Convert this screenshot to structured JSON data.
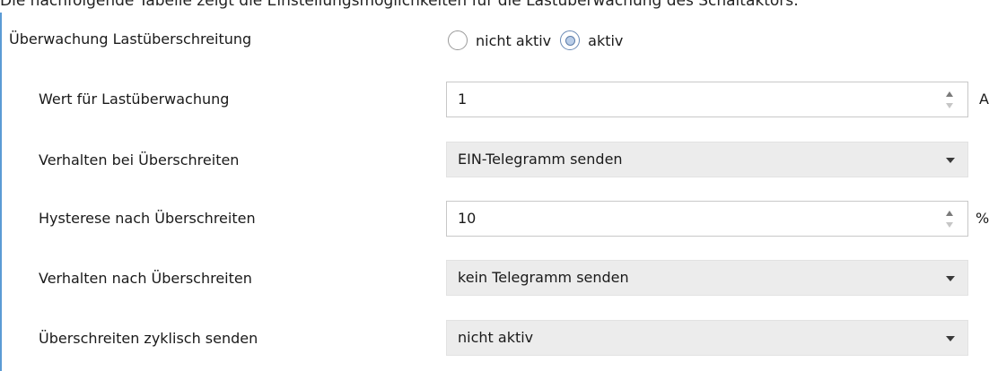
{
  "header_strip": {
    "text": "Die nachfolgende Tabelle zeigt die Einstellungsmöglichkeiten für die Lastüberwachung des Schaltaktors:"
  },
  "monitoring": {
    "label": "Überwachung Lastüberschreitung",
    "options": [
      {
        "label": "nicht aktiv",
        "selected": false
      },
      {
        "label": "aktiv",
        "selected": true
      }
    ]
  },
  "rows": [
    {
      "label": "Wert für Lastüberwachung",
      "type": "spinbox",
      "value": "1",
      "unit": "A"
    },
    {
      "label": "Verhalten bei Überschreiten",
      "type": "dropdown",
      "value": "EIN-Telegramm senden"
    },
    {
      "label": "Hysterese nach Überschreiten",
      "type": "spinbox",
      "value": "10",
      "unit": "%"
    },
    {
      "label": "Verhalten nach Überschreiten",
      "type": "dropdown",
      "value": "kein Telegramm senden"
    },
    {
      "label": "Überschreiten zyklisch senden",
      "type": "dropdown",
      "value": "nicht aktiv"
    }
  ],
  "colors": {
    "panel_border": "#5b9bd5",
    "dropdown_bg": "#ececec",
    "radio_accent": "#5c7ca8"
  },
  "icons": {
    "spin": "spin-arrows-icon",
    "dropdown": "chevron-down-icon",
    "radio": "radio-icon"
  }
}
